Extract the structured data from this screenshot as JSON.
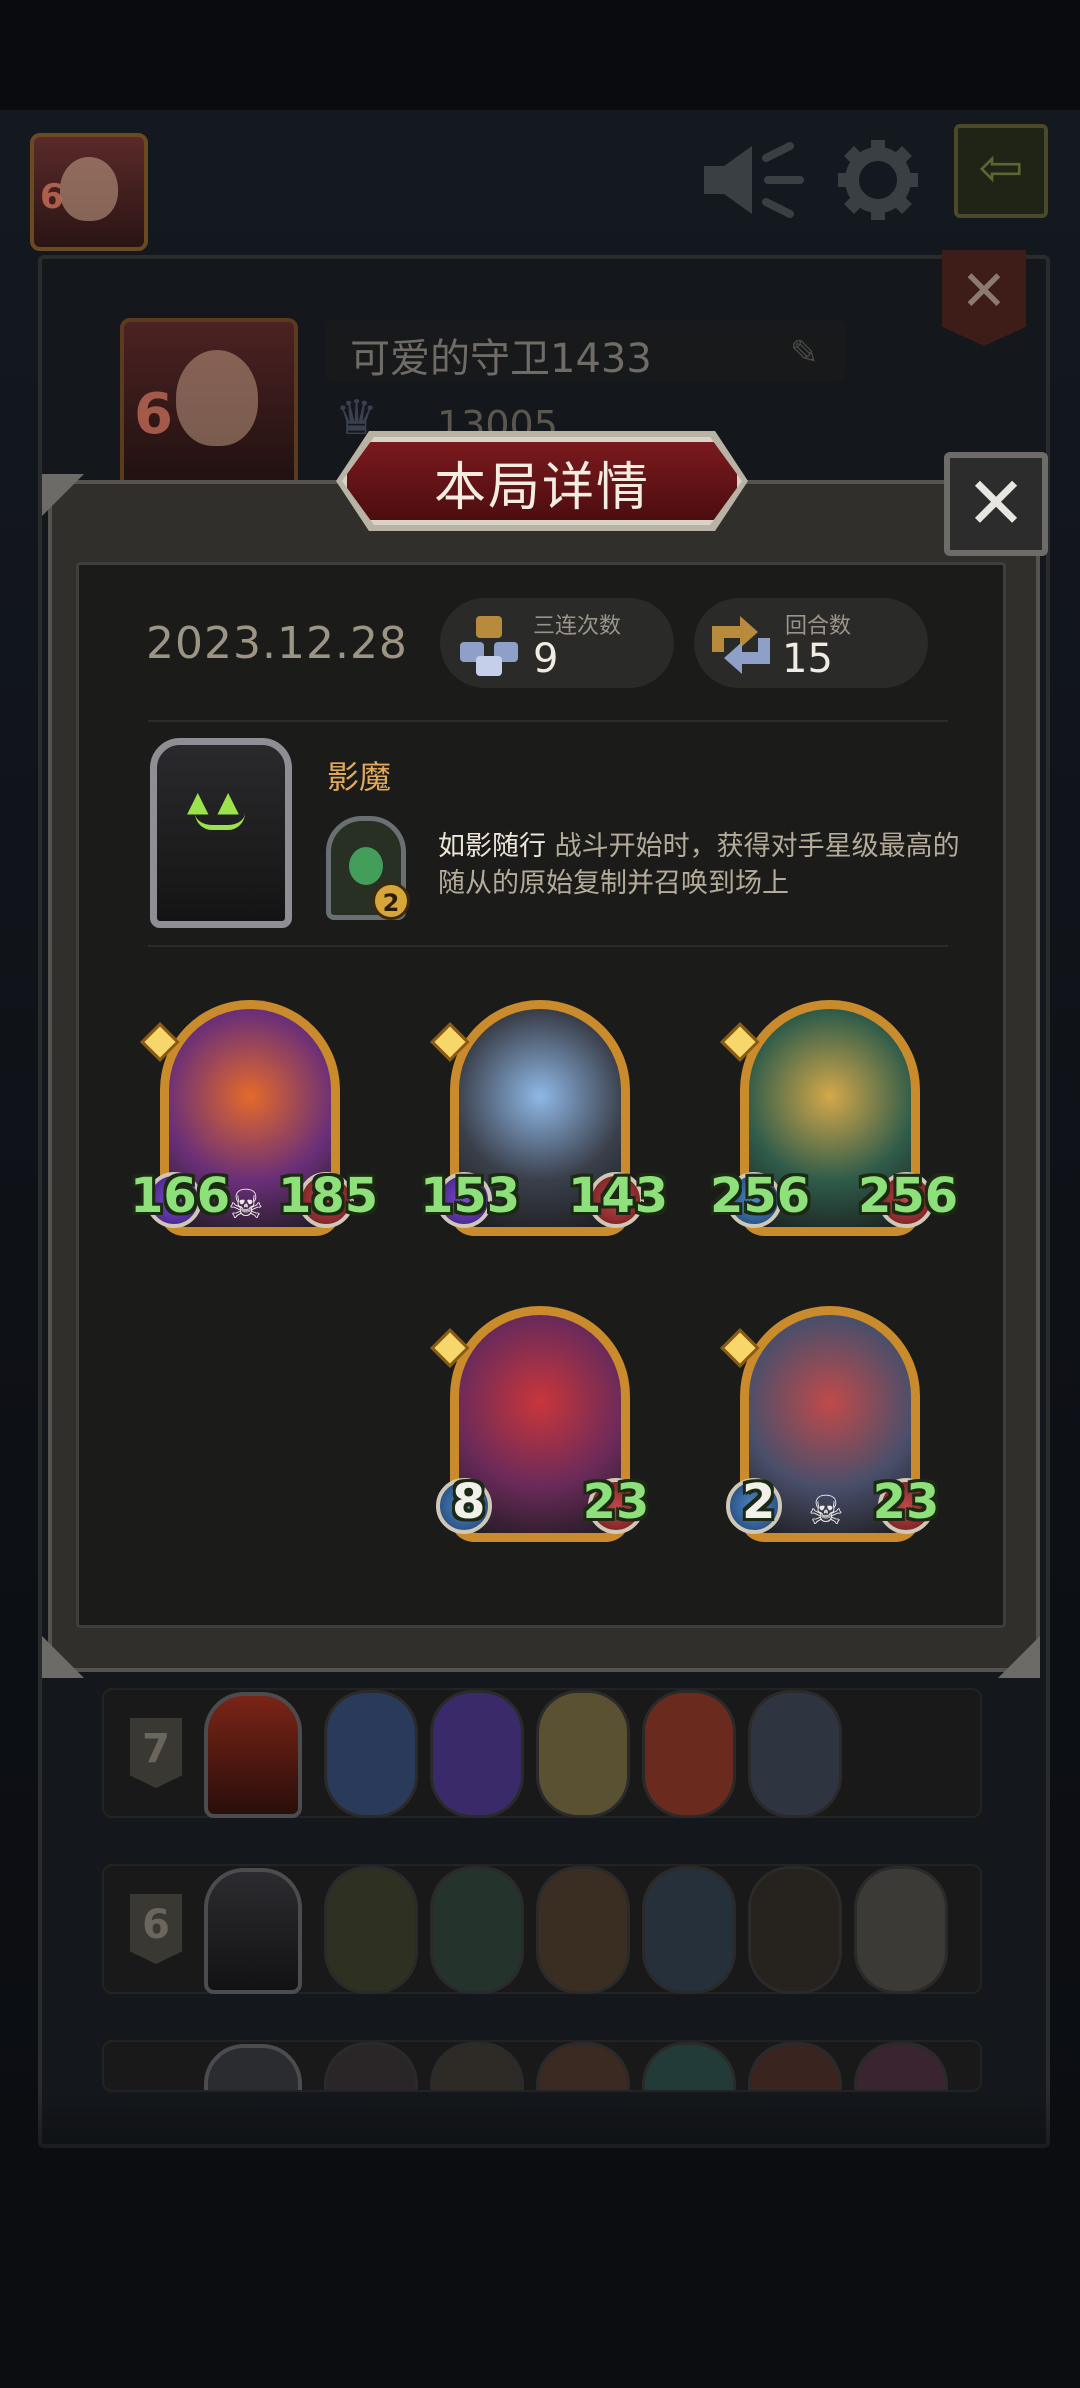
{
  "top_bar": {
    "player_level": "6",
    "icons": [
      "mute-speaker-icon",
      "gear-icon",
      "exit-arrow-icon"
    ]
  },
  "profile": {
    "level": "6",
    "name": "可爱的守卫1433",
    "score": "13005"
  },
  "modal": {
    "title": "本局详情",
    "close_icon": "close-icon",
    "date": "2023.12.28",
    "stats": [
      {
        "label": "三连次数",
        "value": "9",
        "icon": "triple-icon"
      },
      {
        "label": "回合数",
        "value": "15",
        "icon": "rounds-icon"
      }
    ],
    "hero": {
      "name": "影魔",
      "skill_level": "2",
      "skill_name": "如影随行",
      "skill_desc": " 战斗开始时，获得对手星级最高的随从的原始复制并召唤到场上"
    },
    "minions": [
      {
        "name": "demon-bull",
        "attack": "166",
        "health": "185",
        "attack_color": "purple",
        "skull": true,
        "colors": [
          "#6a2f78",
          "#e46a2a"
        ]
      },
      {
        "name": "black-panther",
        "attack": "153",
        "health": "143",
        "attack_color": "purple",
        "skull": false,
        "colors": [
          "#3a3f4a",
          "#8fb8e6"
        ]
      },
      {
        "name": "green-parrot",
        "attack": "256",
        "health": "256",
        "attack_color": "blue",
        "skull": false,
        "colors": [
          "#2f5c4a",
          "#d4a84a"
        ]
      },
      {
        "name": "clown",
        "attack": "8",
        "health": "23",
        "attack_color": "blue",
        "skull": false,
        "colors": [
          "#6a2a5a",
          "#c9363a"
        ]
      },
      {
        "name": "rat-punk",
        "attack": "2",
        "health": "23",
        "attack_color": "blue",
        "skull": true,
        "colors": [
          "#4a4f6a",
          "#c04a4a"
        ]
      }
    ]
  },
  "history": [
    {
      "rank": "7"
    },
    {
      "rank": "6"
    }
  ]
}
